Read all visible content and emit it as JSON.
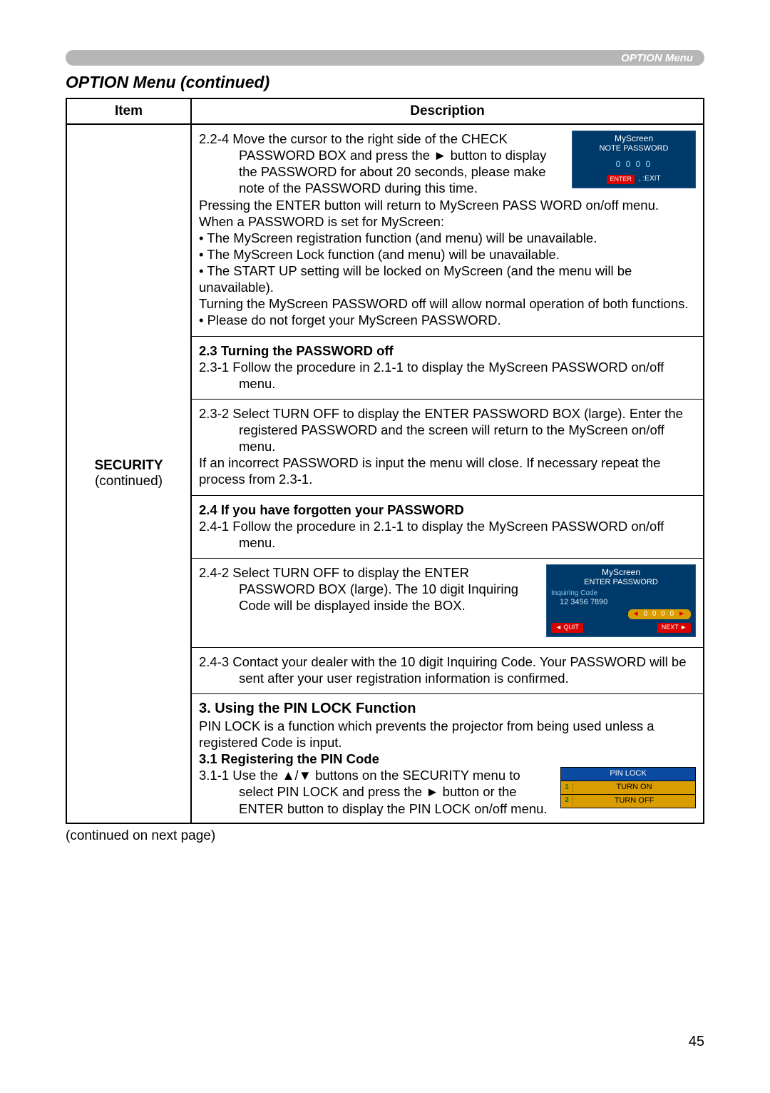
{
  "header_tab": "OPTION Menu",
  "page_title": "OPTION Menu (continued)",
  "table": {
    "headers": {
      "item": "Item",
      "desc": "Description"
    },
    "item_cell": {
      "title": "SECURITY",
      "sub": "(continued)"
    }
  },
  "sec_a": {
    "p224": "2.2-4 Move the cursor to the right side of the CHECK PASSWORD BOX and press the ► button to display the PASSWORD for about 20 seconds, please make note of the PASSWORD during this time.",
    "line2": "Pressing the ENTER button will return to MyScreen PASS WORD on/off menu.",
    "line3": "When a PASSWORD is set for MyScreen:",
    "b1": "• The MyScreen registration function (and menu) will be unavailable.",
    "b2": "• The MyScreen Lock function (and menu) will be unavailable.",
    "b3": "• The START UP setting will be locked on MyScreen (and the menu will be unavailable).",
    "line4": "Turning the MyScreen PASSWORD off will allow normal operation of both functions.",
    "b4": "• Please do not forget your MyScreen PASSWORD.",
    "osd": {
      "title1": "MyScreen",
      "title2": "NOTE PASSWORD",
      "digits": "0 0 0 0",
      "enter": "ENTER",
      "exit": ",      :EXIT"
    }
  },
  "sec_b": {
    "h": "2.3 Turning the PASSWORD off",
    "p231": "2.3-1 Follow the procedure in 2.1-1 to display the MyScreen PASSWORD on/off menu.",
    "p232a": "2.3-2 Select TURN OFF to display the ENTER PASSWORD BOX (large). Enter the registered PASSWORD and the screen will return to the MyScreen on/off menu.",
    "p232b": "If an incorrect PASSWORD is input the menu will close. If necessary repeat the process from 2.3-1."
  },
  "sec_c": {
    "h": "2.4 If you have forgotten your PASSWORD",
    "p241": "2.4-1 Follow the procedure in 2.1-1 to display the MyScreen PASSWORD on/off menu.",
    "p242": "2.4-2 Select TURN OFF to display the ENTER PASSWORD BOX (large). The 10 digit Inquiring Code will be displayed inside the BOX.",
    "p243": "2.4-3 Contact your dealer with the 10 digit Inquiring Code. Your PASSWORD will be sent after your user registration information is confirmed.",
    "osd": {
      "title1": "MyScreen",
      "title2": "ENTER PASSWORD",
      "iq": "Inquiring Code",
      "code": "12 3456 7890",
      "digits": "0 0 0 0",
      "quit": "◄ QUIT",
      "next": "NEXT ►"
    }
  },
  "sec_d": {
    "h": "3. Using the PIN LOCK Function",
    "intro": "PIN LOCK is a function which prevents the projector from being used unless a registered Code is input.",
    "h31": "3.1 Registering the PIN Code",
    "p311": "3.1-1 Use the ▲/▼ buttons on the SECURITY menu to select PIN LOCK and press the ► button or the ENTER button to display the PIN LOCK on/off menu.",
    "osd": {
      "title": "PIN LOCK",
      "o1": "TURN ON",
      "o2": "TURN OFF"
    }
  },
  "footer": "(continued on next page)",
  "page_number": "45"
}
